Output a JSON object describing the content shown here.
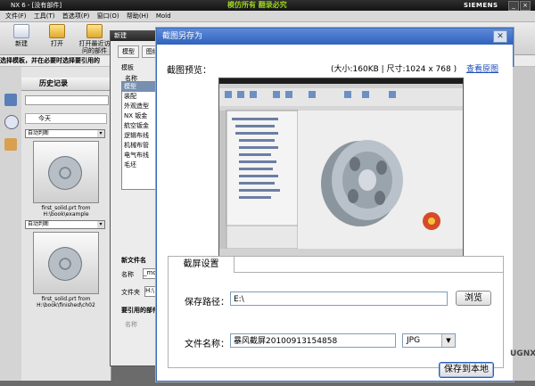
{
  "nx": {
    "title": "NX 6 - [没有部件]",
    "title_center": "模仿所有 翻录必究",
    "brand": "SIEMENS",
    "menu": [
      "文件(F)",
      "工具(T)",
      "首选项(P)",
      "窗口(O)",
      "帮助(H)",
      "Mold"
    ],
    "toolbar": [
      {
        "label": "新建",
        "icon": "new-file-icon"
      },
      {
        "label": "打开",
        "icon": "open-folder-icon"
      },
      {
        "label": "打开最近访问的部件",
        "icon": "recent-folder-icon"
      }
    ],
    "cue_line": "选择模板，并在必要时选择要引用的",
    "history": {
      "title": "历史记录",
      "today": "今天",
      "items": [
        {
          "mode": "自动判断",
          "caption": "first_solid.prt from H:\\book\\example"
        },
        {
          "mode": "自动判断",
          "caption": "first_solid.prt from H:\\book\\finished\\ch02"
        }
      ]
    }
  },
  "new_dialog": {
    "title": "新建",
    "tabs": [
      "模型",
      "图纸"
    ],
    "template_label": "模板",
    "name_col": "名称",
    "templates": [
      "模型",
      "装配",
      "外观造型",
      "NX 钣金",
      "航空钣金",
      "逻辑布线",
      "机械布管",
      "电气布线",
      "毛坯"
    ],
    "new_file_label": "新文件名",
    "name_label": "名称",
    "name_value": "_mo",
    "folder_label": "文件夹",
    "folder_value": "H:\\",
    "ref_label": "要引用的部件",
    "ref_name_label": "名称"
  },
  "save_dialog": {
    "title": "截图另存为",
    "preview_label": "截图预览：",
    "size_info": "(大小:160KB | 尺寸:1024 x 768 )",
    "view_original": "查看原图",
    "settings_tab": "截屏设置",
    "path_label": "保存路径：",
    "path_value": "E:\\",
    "browse": "浏览",
    "filename_label": "文件名称：",
    "filename_value": "暴风截屏20100913154858",
    "format": "JPG",
    "save_button": "保存到本地"
  },
  "watermark": "UGNX"
}
